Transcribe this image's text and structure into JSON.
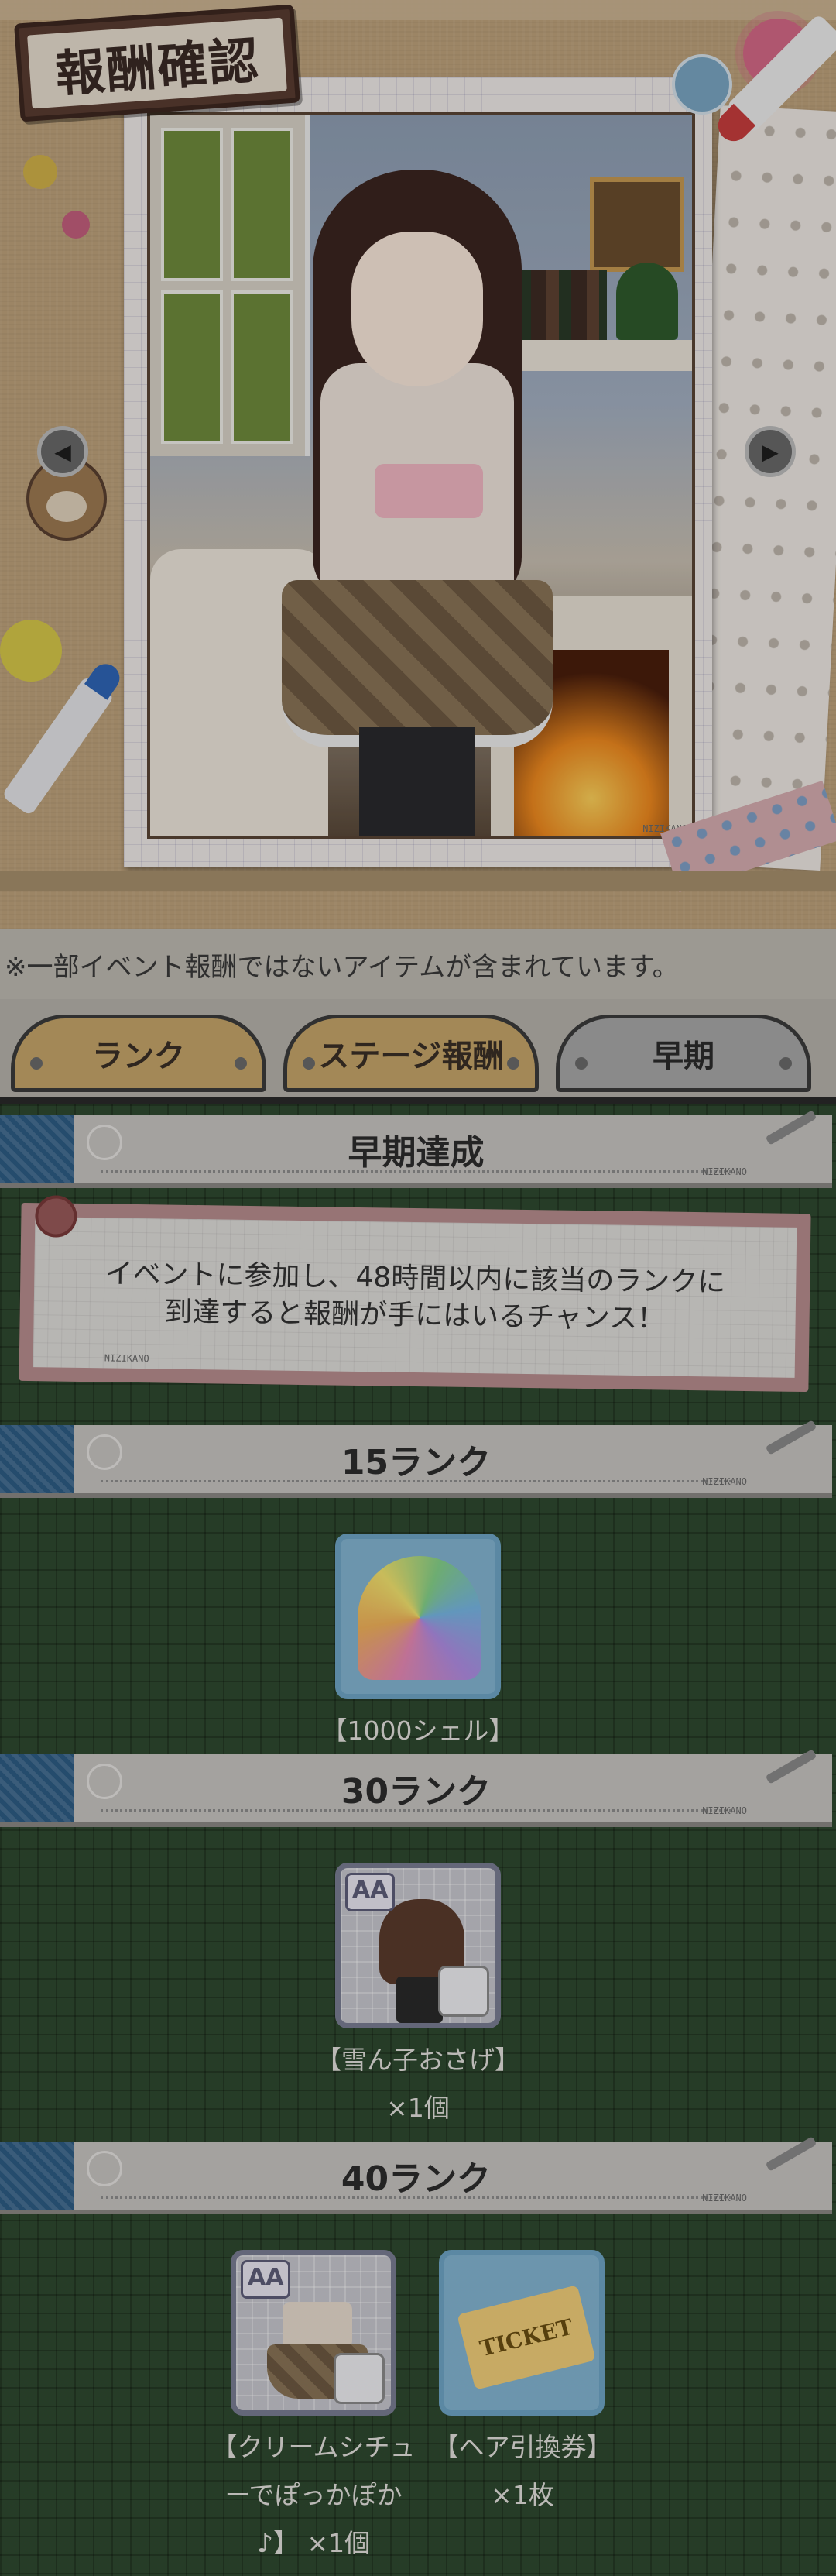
{
  "page": {
    "title": "報酬確認",
    "art_watermark": "NIZIKANO",
    "notice": "※一部イベント報酬ではないアイテムが含まれています。"
  },
  "tabs": [
    {
      "label": "ランク",
      "selected": false
    },
    {
      "label": "ステージ報酬",
      "selected": false
    },
    {
      "label": "早期",
      "selected": true
    }
  ],
  "sections": {
    "early": {
      "title": "早期達成",
      "description_line1": "イベントに参加し、48時間以内に該当のランクに",
      "description_line2": "到達すると報酬が手にはいるチャンス！"
    },
    "rank15": {
      "title": "15ランク",
      "rewards": [
        {
          "name": "【1000シェル】",
          "icon": "shell-icon"
        }
      ]
    },
    "rank30": {
      "title": "30ランク",
      "rewards": [
        {
          "name": "【雪ん子おさげ】",
          "qty": "×1個",
          "badge": "AA",
          "icon": "hairstyle-icon"
        }
      ]
    },
    "rank40": {
      "title": "40ランク",
      "rewards": [
        {
          "name_line1": "【クリームシチュ",
          "name_line2": "ーでぽっかぽか",
          "name_line3": "♪】 ×1個",
          "badge": "AA",
          "icon": "outfit-icon"
        },
        {
          "name": "【ヘア引換券】",
          "qty": "×1枚",
          "ticket_text": "TICKET",
          "icon": "ticket-icon"
        }
      ]
    }
  },
  "header_watermark": "NIZIKANO",
  "colors": {
    "board": "#2f4a30",
    "tab_active": "#a9a9a9",
    "tab_inactive": "#c7a76b",
    "header_bar": "#c9c6c3",
    "header_stub": "#2e5d86"
  }
}
